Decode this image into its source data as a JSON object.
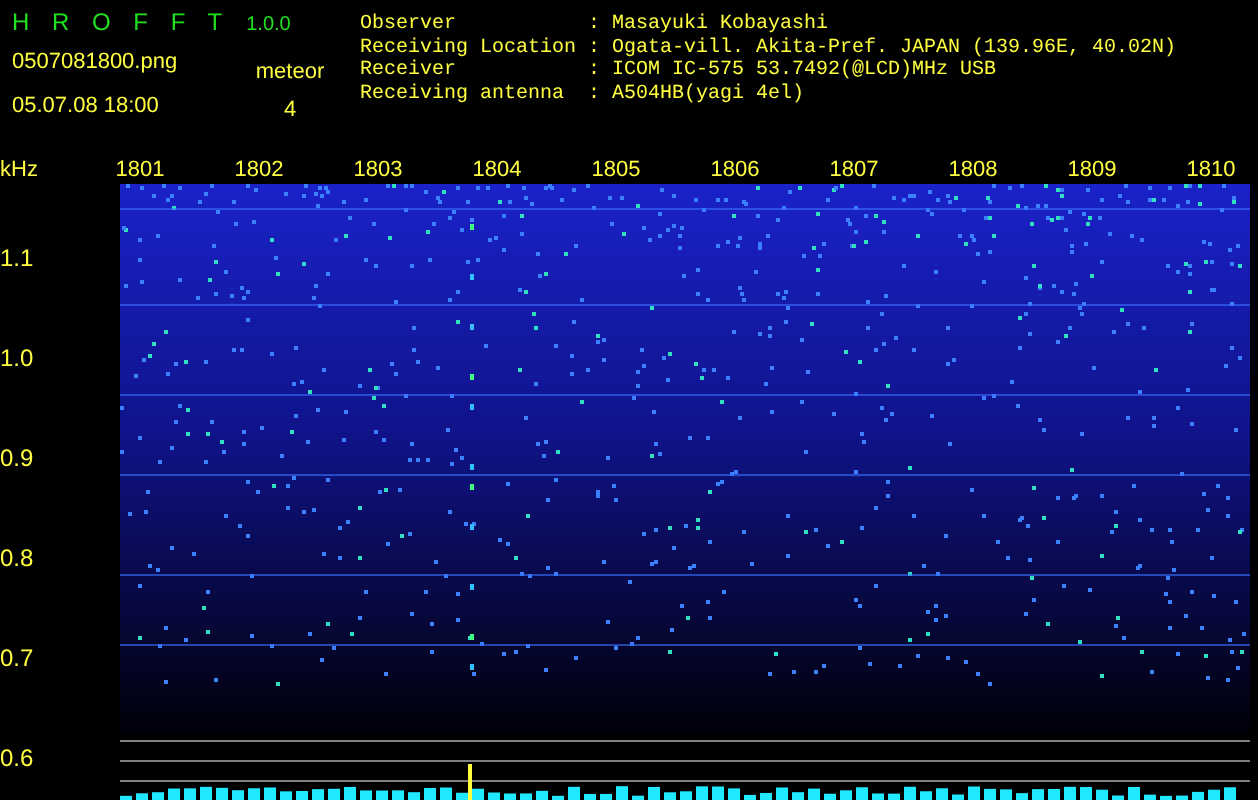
{
  "app": {
    "title": "H R O F F T",
    "version": "1.0.0"
  },
  "file": {
    "name": "0507081800.png",
    "datetime": "05.07.08 18:00"
  },
  "meteor": {
    "label": "meteor",
    "count": "4"
  },
  "info": [
    {
      "label": "Observer",
      "separator": ":",
      "value": "Masayuki Kobayashi"
    },
    {
      "label": "Receiving Location",
      "separator": ":",
      "value": "Ogata-vill. Akita-Pref. JAPAN (139.96E, 40.02N)"
    },
    {
      "label": "Receiver",
      "separator": ":",
      "value": "ICOM IC-575 53.7492(@LCD)MHz USB"
    },
    {
      "label": "Receiving antenna",
      "separator": ":",
      "value": "A504HB(yagi 4el)"
    }
  ],
  "axis": {
    "y_unit": "kHz",
    "x_labels": [
      "1801",
      "1802",
      "1803",
      "1804",
      "1805",
      "1806",
      "1807",
      "1808",
      "1809",
      "1810"
    ],
    "y_labels": [
      "1.1",
      "1.0",
      "0.9",
      "0.8",
      "0.7",
      "0.6"
    ]
  }
}
